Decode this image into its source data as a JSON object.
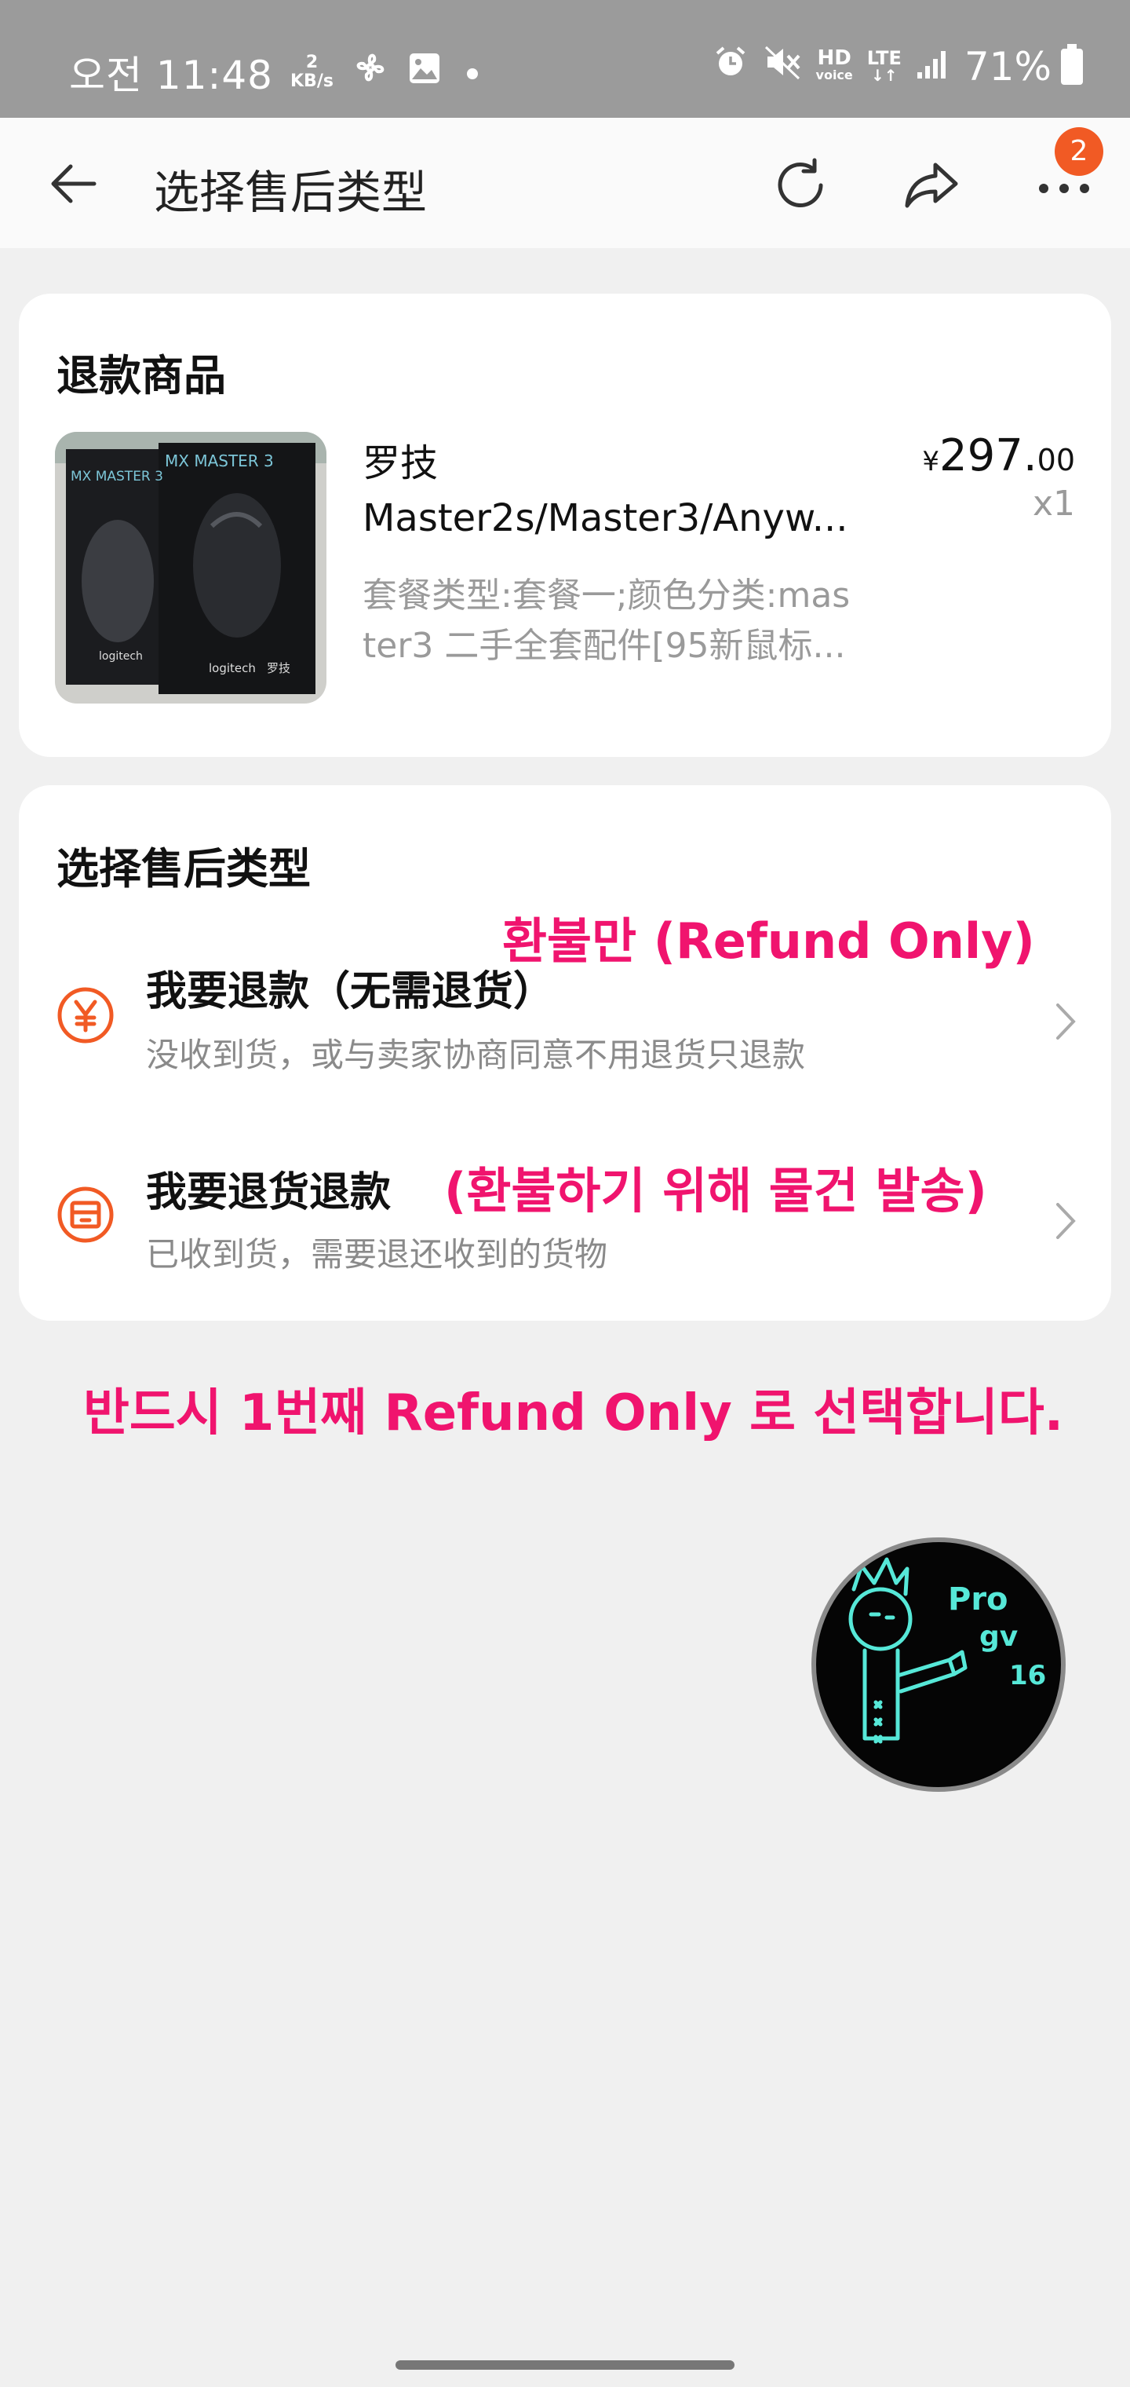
{
  "status_bar": {
    "time": "오전 11:48",
    "speed_value": "2",
    "speed_unit": "KB/s",
    "network_hd": "HD",
    "network_voice": "voice",
    "network_lte": "LTE",
    "battery": "71%"
  },
  "header": {
    "title": "选择售后类型",
    "notification_count": "2"
  },
  "refund_goods": {
    "heading": "退款商品",
    "product": {
      "name_line1": "罗技",
      "name_line2": "Master2s/Master3/Anyw...",
      "spec_line1": "套餐类型:套餐一;颜色分类:mas",
      "spec_line2": "ter3 二手全套配件[95新鼠标...",
      "price_currency": "¥",
      "price_integer": "297.",
      "price_decimal": "00",
      "quantity": "x1",
      "image_label_left": "MX MASTER 3",
      "image_label_right": "MX MASTER 3",
      "image_brand": "logitech",
      "image_brand_cn": "罗技"
    }
  },
  "aftersale_type": {
    "heading": "选择售后类型",
    "options": [
      {
        "title": "我要退款（无需退货）",
        "description": "没收到货，或与卖家协商同意不用退货只退款"
      },
      {
        "title": "我要退货退款",
        "description": "已收到货，需要退还收到的货物"
      }
    ]
  },
  "annotations": {
    "refund_only": "환불만 (Refund Only)",
    "return_refund": "(환불하기 위해 물건 발송)",
    "instruction": "반드시 1번째 Refund Only 로 선택합니다."
  },
  "watermark": {
    "line1": "Pro",
    "line2": "gv",
    "line3": "16"
  },
  "colors": {
    "accent_orange": "#f15a24",
    "annotation_pink": "#f0146e",
    "watermark_cyan": "#56e8d8"
  }
}
